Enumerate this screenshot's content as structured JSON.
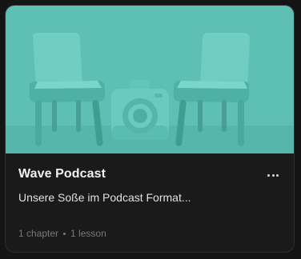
{
  "card": {
    "title": "Wave Podcast",
    "description": "Unsere Soße im Podcast Format...",
    "chapters": "1 chapter",
    "lessons": "1 lesson",
    "thumbnail_color": "#5ebfb4",
    "more_icon": "more-horizontal-icon"
  }
}
